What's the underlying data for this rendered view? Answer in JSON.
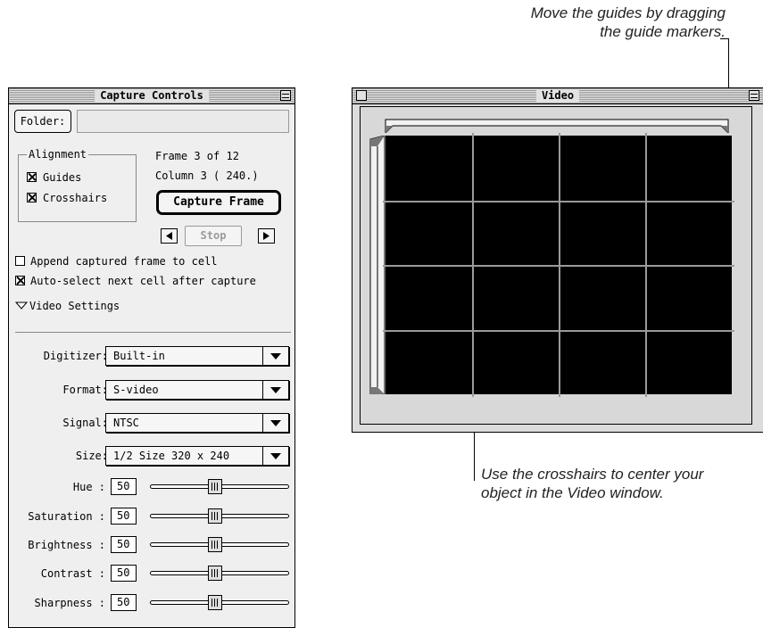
{
  "annotations": {
    "top_line1": "Move the guides by dragging",
    "top_line2": "the guide markers.",
    "bottom_line1": "Use the crosshairs to center your",
    "bottom_line2": "object in the Video window."
  },
  "capture_controls": {
    "title": "Capture Controls",
    "folder_button": "Folder:",
    "folder_value": "",
    "alignment": {
      "title": "Alignment",
      "guides_label": "Guides",
      "guides_checked": true,
      "crosshairs_label": "Crosshairs",
      "crosshairs_checked": true
    },
    "frame_text": "Frame  3  of  12",
    "column_text": "Column  3  ( 240.)",
    "capture_frame_button": "Capture Frame",
    "stop_button": "Stop",
    "append_label": "Append captured frame to cell",
    "append_checked": false,
    "autoselect_label": "Auto-select next cell after capture",
    "autoselect_checked": true,
    "video_settings_label": "Video Settings",
    "popups": [
      {
        "label": "Digitizer:",
        "value": "Built-in"
      },
      {
        "label": "Format:",
        "value": "S-video"
      },
      {
        "label": "Signal:",
        "value": "NTSC"
      },
      {
        "label": "Size:",
        "value": "1/2 Size  320 x 240"
      }
    ],
    "sliders": [
      {
        "label": "Hue :",
        "value": "50",
        "fraction": 0.5
      },
      {
        "label": "Saturation :",
        "value": "50",
        "fraction": 0.5
      },
      {
        "label": "Brightness :",
        "value": "50",
        "fraction": 0.5
      },
      {
        "label": "Contrast :",
        "value": "50",
        "fraction": 0.5
      },
      {
        "label": "Sharpness :",
        "value": "50",
        "fraction": 0.5
      }
    ]
  },
  "video_window": {
    "title": "Video",
    "grid_columns": 4,
    "grid_rows": 4
  }
}
